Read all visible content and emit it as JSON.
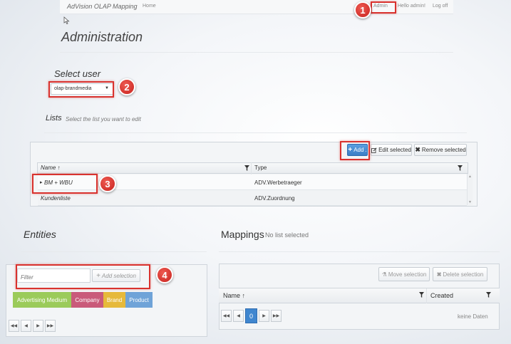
{
  "navbar": {
    "brand": "AdVision OLAP Mapping",
    "home": "Home",
    "admin": "Admin",
    "hello": "Hello admin!",
    "logoff": "Log off"
  },
  "page": {
    "title": "Administration"
  },
  "select_user": {
    "label": "Select user",
    "value": "olap-brandmedia"
  },
  "lists": {
    "title": "Lists",
    "subtitle": "Select the list you want to edit",
    "toolbar": {
      "add": "Add",
      "edit": "Edit selected",
      "remove": "Remove selected"
    },
    "columns": [
      "Name ↑",
      "Type"
    ],
    "rows": [
      {
        "name": "BM + WBU",
        "type": "ADV.Werbetraeger"
      },
      {
        "name": "Kundenliste",
        "type": "ADV.Zuordnung"
      }
    ]
  },
  "entities": {
    "title": "Entities",
    "filter_placeholder": "Filter",
    "add_selection": "Add selection",
    "tags": [
      {
        "label": "Advertising Medium",
        "color": "#9bcb5a"
      },
      {
        "label": "Company",
        "color": "#c95a7a"
      },
      {
        "label": "Brand",
        "color": "#e6b93b"
      },
      {
        "label": "Product",
        "color": "#6fa3d8"
      }
    ]
  },
  "mappings": {
    "title": "Mappings",
    "subtitle": "No list selected",
    "move": "Move selection",
    "delete": "Delete selection",
    "columns": [
      "Name ↑",
      "Created"
    ],
    "page": "0",
    "empty": "keine Daten"
  },
  "callouts": [
    "1",
    "2",
    "3",
    "4"
  ],
  "colors": {
    "callout": "#d9322e",
    "primary_button": "#3c7fc6"
  }
}
